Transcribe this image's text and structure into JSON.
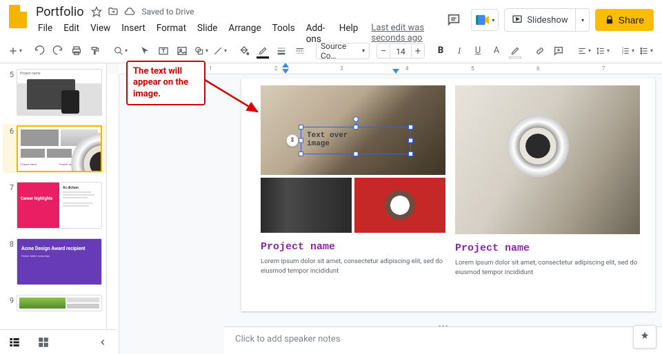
{
  "header": {
    "doc_title": "Portfolio",
    "saved_text": "Saved to Drive",
    "last_edit": "Last edit was seconds ago"
  },
  "menubar": [
    "File",
    "Edit",
    "View",
    "Insert",
    "Format",
    "Slide",
    "Arrange",
    "Tools",
    "Add-ons",
    "Help"
  ],
  "actions": {
    "slideshow": "Slideshow",
    "share": "Share"
  },
  "toolbar": {
    "font_family": "Source Co…",
    "font_size": "14",
    "minus": "−",
    "plus": "+"
  },
  "ruler": {
    "n1": "1",
    "n2": "2",
    "n3": "3",
    "n4": "4",
    "n5": "5",
    "n6": "6",
    "n7": "7"
  },
  "filmstrip": {
    "slides": [
      {
        "num": "5",
        "title": "Project name"
      },
      {
        "num": "6",
        "title": "Project name"
      },
      {
        "num": "7",
        "title": "Career highlights"
      },
      {
        "num": "8",
        "title": "Acme Design Award recipient"
      },
      {
        "num": "9",
        "title": ""
      }
    ]
  },
  "thumbs": {
    "t5_title": "Project name",
    "t6_label1": "Project name",
    "t6_label2": "Project name",
    "t7_title": "Career highlights",
    "t7_sub": "Ac dictum",
    "t8_title": "Acme Design Award recipient",
    "t8_sub": "Parker Matic campaign"
  },
  "slide": {
    "textbox_line1": "Text over",
    "textbox_line2": "image",
    "left": {
      "title": "Project name",
      "desc": "Lorem ipsum dolor sit amet, consectetur adipiscing elit, sed do eiusmod tempor incididunt"
    },
    "right": {
      "title": "Project name",
      "desc": "Lorem ipsum dolor sit amet, consectetur adipiscing elit, sed do eiusmod tempor incididunt"
    }
  },
  "callout": "The text will appear on the image.",
  "speaker_notes_placeholder": "Click to add speaker notes",
  "colors": {
    "text_color": "#d50000",
    "highlight_color": "#ffffff"
  }
}
